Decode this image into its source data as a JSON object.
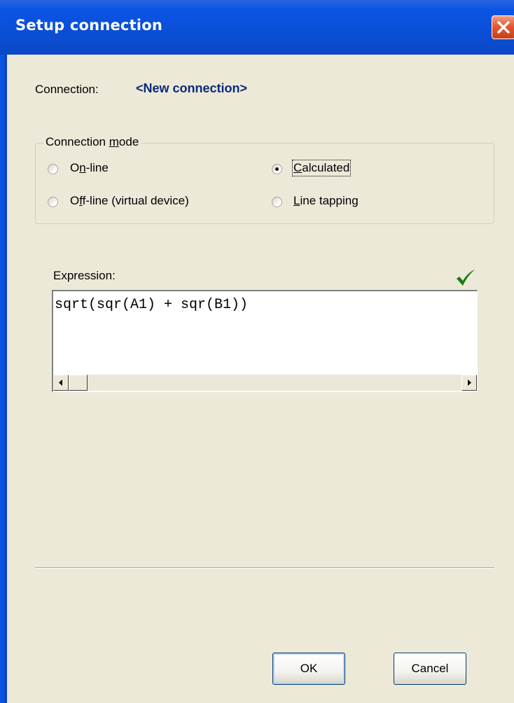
{
  "window": {
    "title": "Setup connection"
  },
  "connection": {
    "label": "Connection:",
    "value": "<New connection>"
  },
  "connection_mode": {
    "legend_pre": "Connection ",
    "legend_accel": "m",
    "legend_post": "ode",
    "options": [
      {
        "pre": "O",
        "accel": "n",
        "post": "-line",
        "checked": false
      },
      {
        "pre": "",
        "accel": "C",
        "post": "alculated",
        "checked": true
      },
      {
        "pre": "O",
        "accel": "f",
        "post": "f-line (virtual device)",
        "checked": false
      },
      {
        "pre": "",
        "accel": "L",
        "post": "ine tapping",
        "checked": false
      }
    ]
  },
  "expression": {
    "label": "Expression:",
    "value": "sqrt(sqr(A1) + sqr(B1))",
    "valid_icon": "checkmark-icon",
    "valid_color": "#1a7a10"
  },
  "buttons": {
    "ok": "OK",
    "cancel": "Cancel"
  },
  "colors": {
    "titlebar": "#0b54e4",
    "window_bg": "#ece9d8",
    "close_button": "#e35930",
    "connection_value": "#0a2a7a"
  }
}
